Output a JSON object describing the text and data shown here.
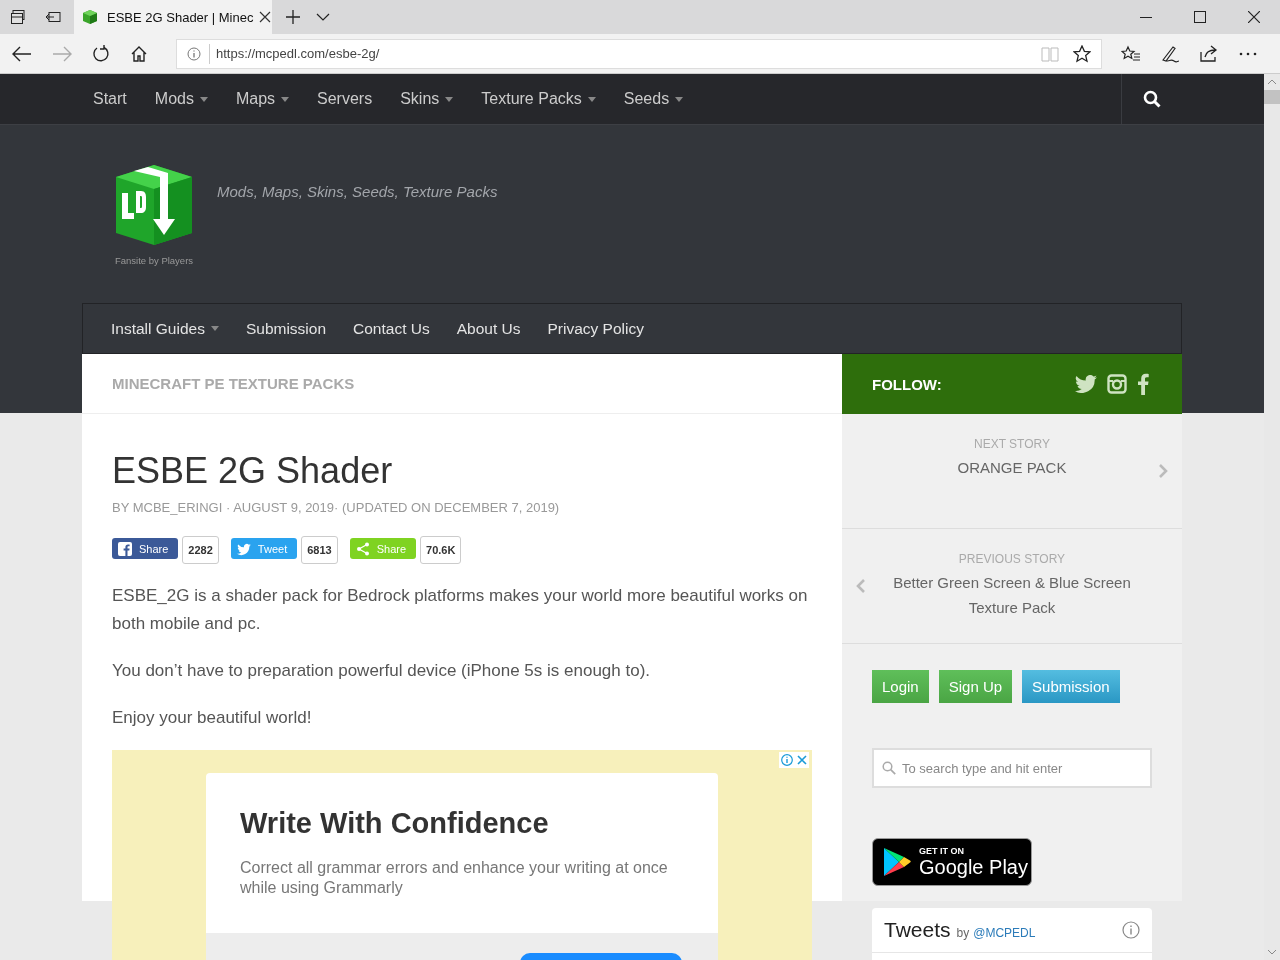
{
  "browser": {
    "tabs": [
      {
        "title": "ESBE 2G Shader | Minec",
        "selected": true
      }
    ],
    "address_bar": {
      "url": "https://mcpedl.com/esbe-2g/"
    }
  },
  "top_nav": {
    "items": [
      {
        "label": "Start",
        "has_dropdown": false
      },
      {
        "label": "Mods",
        "has_dropdown": true
      },
      {
        "label": "Maps",
        "has_dropdown": true
      },
      {
        "label": "Servers",
        "has_dropdown": false
      },
      {
        "label": "Skins",
        "has_dropdown": true
      },
      {
        "label": "Texture Packs",
        "has_dropdown": true
      },
      {
        "label": "Seeds",
        "has_dropdown": true
      }
    ]
  },
  "header": {
    "logo_caption": "Fansite by Players",
    "tagline": "Mods, Maps, Skins, Seeds, Texture Packs"
  },
  "sub_nav": {
    "items": [
      {
        "label": "Install Guides",
        "has_dropdown": true
      },
      {
        "label": "Submission",
        "has_dropdown": false
      },
      {
        "label": "Contact Us",
        "has_dropdown": false
      },
      {
        "label": "About Us",
        "has_dropdown": false
      },
      {
        "label": "Privacy Policy",
        "has_dropdown": false
      }
    ]
  },
  "breadcrumb": "MINECRAFT PE TEXTURE PACKS",
  "follow": {
    "label": "FOLLOW:"
  },
  "article": {
    "title": "ESBE 2G Shader",
    "byline": "BY MCBE_ERINGI · AUGUST 9, 2019· (UPDATED ON DECEMBER 7, 2019)",
    "share_buttons": [
      {
        "kind": "facebook",
        "label": "Share",
        "count": "2282"
      },
      {
        "kind": "twitter",
        "label": "Tweet",
        "count": "6813"
      },
      {
        "kind": "share",
        "label": "Share",
        "count": "70.6K"
      }
    ],
    "paragraphs": [
      "ESBE_2G is a shader pack for Bedrock platforms makes your world more beautiful works on both mobile and pc.",
      "You don’t have to preparation powerful device (iPhone 5s is enough to).",
      "Enjoy your beautiful world!"
    ],
    "ad": {
      "title": "Write With Confidence",
      "text": "Correct all grammar errors and enhance your writing at once while using Grammarly"
    }
  },
  "sidebar": {
    "next_story": {
      "label": "NEXT STORY",
      "title": "ORANGE PACK"
    },
    "previous_story": {
      "label": "PREVIOUS STORY",
      "title": "Better Green Screen & Blue Screen Texture Pack"
    },
    "buttons": [
      {
        "label": "Login",
        "kind": "green"
      },
      {
        "label": "Sign Up",
        "kind": "green"
      },
      {
        "label": "Submission",
        "kind": "blue"
      }
    ],
    "search": {
      "placeholder": "To search type and hit enter"
    },
    "google_play": {
      "top": "GET IT ON",
      "bottom": "Google Play"
    },
    "tweets": {
      "title": "Tweets",
      "by": "by",
      "handle": "@MCPEDL"
    }
  }
}
